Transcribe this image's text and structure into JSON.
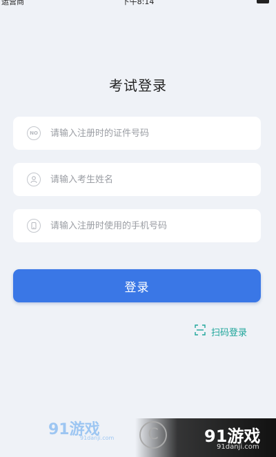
{
  "status_bar": {
    "carrier": "运营商",
    "time": "下午8:14"
  },
  "page": {
    "title": "考试登录"
  },
  "form": {
    "id_number": {
      "placeholder": "请输入注册时的证件号码",
      "value": "",
      "icon": "id-no-icon",
      "icon_text": "NO"
    },
    "name": {
      "placeholder": "请输入考生姓名",
      "value": "",
      "icon": "person-icon"
    },
    "phone": {
      "placeholder": "请输入注册时使用的手机号码",
      "value": "",
      "icon": "phone-icon"
    },
    "login_label": "登录",
    "scan_login_label": "扫码登录"
  },
  "watermarks": {
    "left_logo": "91游戏",
    "left_url": "91danji.com",
    "right_logo": "91游戏",
    "right_url": "91danji.com"
  },
  "colors": {
    "background": "#eff2f7",
    "primary": "#3a77e6",
    "scan_accent": "#1ea59a"
  }
}
